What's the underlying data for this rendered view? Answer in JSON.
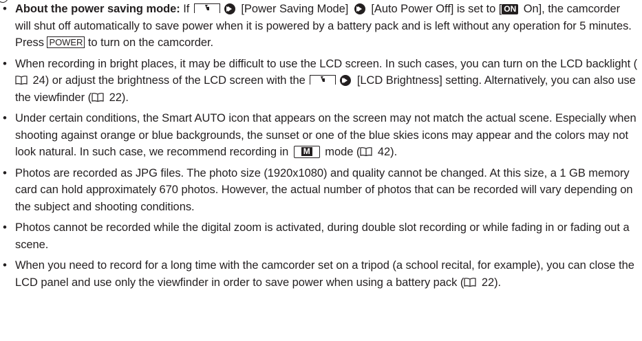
{
  "icons": {
    "setup_menu": "setup-menu-icon",
    "arrow": "arrow-right-icon",
    "on_badge": "ON",
    "power_key": "POWER",
    "book_ref": "book-icon",
    "mode_m": "M"
  },
  "notes": [
    {
      "lead": "About the power saving mode:",
      "t1": " If ",
      "t2": " [Power Saving Mode] ",
      "t3": " [Auto Power Off] is set to [",
      "t4": " On], the camcorder will shut off automatically to save power when it is powered by a battery pack and is left without any operation for 5 minutes. Press ",
      "t5": " to turn on the camcorder."
    },
    {
      "t1": "When recording in bright places, it may be difficult to use the LCD screen. In such cases, you can turn on the LCD backlight (",
      "ref1": " 24",
      "t2": ") or adjust the brightness of the LCD screen with the ",
      "t3": " [LCD Brightness] setting. Alternatively, you can also use the viewfinder (",
      "ref2": " 22",
      "t4": ")."
    },
    {
      "t1": "Under certain conditions, the Smart AUTO icon that appears on the screen may not match the actual scene. Especially when shooting against orange or blue backgrounds, the sunset or one of the blue skies icons may appear and the colors may not look natural. In such case, we recommend recording in ",
      "t2": " mode (",
      "ref1": " 42",
      "t3": ")."
    },
    {
      "text": "Photos are recorded as JPG files. The photo size (1920x1080) and quality cannot be changed. At this size, a 1 GB memory card can hold approximately 670 photos. However, the actual number of photos that can be recorded will vary depending on the subject and shooting conditions."
    },
    {
      "text": "Photos cannot be recorded while the digital zoom is activated, during double slot recording or while fading in or fading out a scene."
    },
    {
      "t1": "When you need to record for a long time with the camcorder set on a tripod (a school recital, for example), you can close the LCD panel and use only the viewfinder in order to save power when using a battery pack (",
      "ref1": " 22",
      "t2": ")."
    }
  ]
}
